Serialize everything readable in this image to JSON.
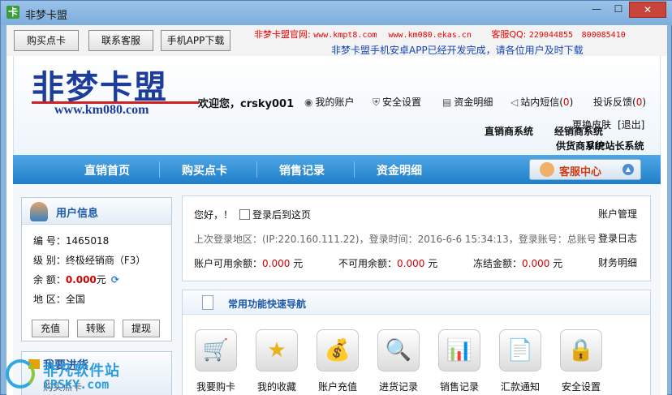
{
  "window": {
    "title": "非梦卡盟",
    "icon_glyph": "卡",
    "min_glyph": "—",
    "max_glyph": "☐",
    "close_glyph": "✕"
  },
  "topbar": {
    "buttons": [
      "购买点卡",
      "联系客服",
      "手机APP下载"
    ],
    "site_label": "非梦卡盟官网:",
    "site_url1": "www.kmpt8.com",
    "site_url2": "www.km080.ekas.cn",
    "qq_label": "客服QQ:",
    "qq1": "229044855",
    "qq2": "800085410",
    "notice": "非梦卡盟手机安卓APP已经开发完成，请各位用户及时下载"
  },
  "header": {
    "logo_text": "非梦卡盟",
    "logo_url": "www.km080.com",
    "welcome": "欢迎您，crsky001",
    "links": {
      "account": "我的账户",
      "security": "安全设置",
      "funds": "资金明细",
      "messages": "站内短信(",
      "messages_count": "0",
      "feedback": "投诉反馈(",
      "feedback_count": "0",
      "close_paren": ")"
    },
    "systems": {
      "replace_skin": "更换皮肤",
      "exit": "[退出]",
      "direct": "直销商系统",
      "dealer": "经销商系统",
      "supplier": "供货商系统",
      "vip": "VIP站长系统"
    }
  },
  "nav": {
    "items": [
      "直销首页",
      "购买点卡",
      "销售记录",
      "资金明细"
    ],
    "service_center": "客服中心"
  },
  "user_info": {
    "title": "用户信息",
    "id_label": "编  号：",
    "id_value": "1465018",
    "level_label": "级  别：",
    "level_value": "终极经销商（F3）",
    "balance_label": "余  额：",
    "balance_value": "0.000",
    "balance_unit": "元",
    "region_label": "地  区：",
    "region_value": "全国",
    "buttons": [
      "充值",
      "转账",
      "提现"
    ]
  },
  "buy_panel": {
    "title": "我要进货",
    "sub_item": "购买点卡"
  },
  "account_panel": {
    "greeting": "您好，！",
    "login_checkbox_label": "登录后到这页",
    "account_manage": "账户管理",
    "last_login": "上次登录地区：(IP:220.160.111.22)，登录时间：2016-6-6 15:34:13，登录账号：总账号",
    "login_log": "登录日志",
    "available_label": "账户可用余额：",
    "available_value": "0.000",
    "unavailable_label": "不可用余额：",
    "unavailable_value": "0.000",
    "frozen_label": "冻结金额：",
    "frozen_value": "0.000",
    "unit": "元",
    "finance_detail": "财务明细"
  },
  "quick_nav": {
    "title": "常用功能快速导航",
    "items": [
      {
        "label": "我要购卡",
        "icon": "cart-icon",
        "glyph": "🛒"
      },
      {
        "label": "我的收藏",
        "icon": "star-icon",
        "glyph": "★"
      },
      {
        "label": "账户充值",
        "icon": "coins-add-icon",
        "glyph": "💰"
      },
      {
        "label": "进货记录",
        "icon": "magnifier-icon",
        "glyph": "🔍"
      },
      {
        "label": "销售记录",
        "icon": "bar-chart-icon",
        "glyph": "📊"
      },
      {
        "label": "汇款通知",
        "icon": "document-icon",
        "glyph": "📄"
      },
      {
        "label": "安全设置",
        "icon": "lock-icon",
        "glyph": "🔒"
      }
    ]
  },
  "watermark": {
    "line1": "非凡软件站",
    "line2": "CRSKY.com"
  },
  "colors": {
    "accent_blue": "#1f7ec9",
    "price_red": "#d40000",
    "link_blue": "#1646b8"
  }
}
